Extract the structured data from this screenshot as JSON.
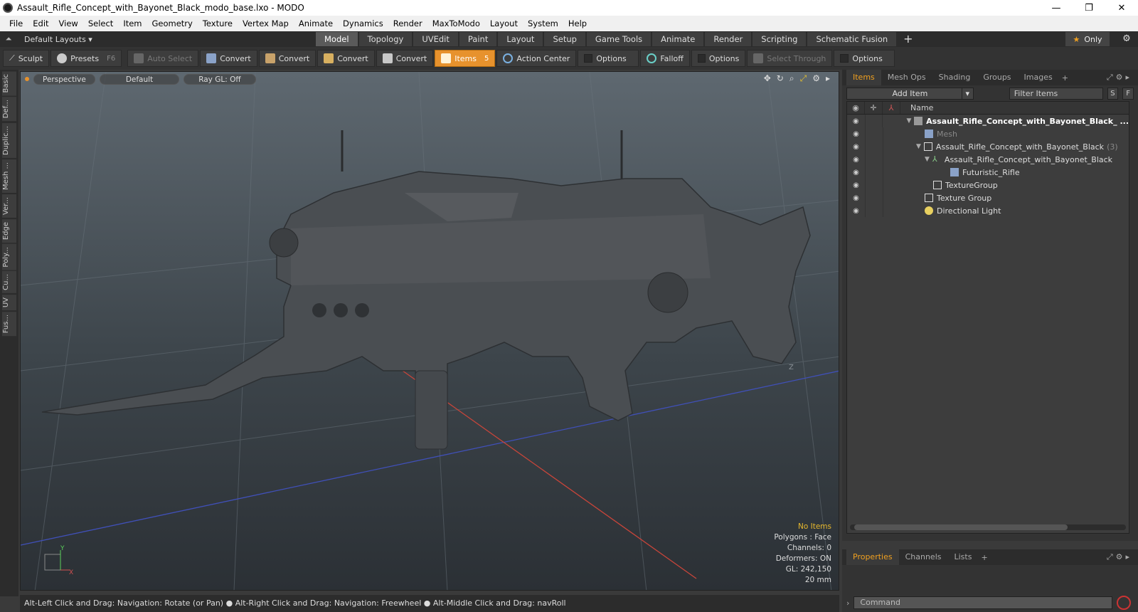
{
  "window": {
    "title": "Assault_Rifle_Concept_with_Bayonet_Black_modo_base.lxo - MODO",
    "minimize": "—",
    "maximize": "❐",
    "close": "✕"
  },
  "menu": [
    "File",
    "Edit",
    "View",
    "Select",
    "Item",
    "Geometry",
    "Texture",
    "Vertex Map",
    "Animate",
    "Dynamics",
    "Render",
    "MaxToModo",
    "Layout",
    "System",
    "Help"
  ],
  "layoutbar": {
    "layout_select": "Default Layouts ▾",
    "tabs": [
      "Model",
      "Topology",
      "UVEdit",
      "Paint",
      "Layout",
      "Setup",
      "Game Tools",
      "Animate",
      "Render",
      "Scripting",
      "Schematic Fusion"
    ],
    "active_tab": "Model",
    "add": "+",
    "only_label": "Only",
    "star": "★"
  },
  "toolbar": {
    "sculpt": "Sculpt",
    "presets": "Presets",
    "presets_key": "F6",
    "auto_select": "Auto Select",
    "convert1": "Convert",
    "convert2": "Convert",
    "convert3": "Convert",
    "convert4": "Convert",
    "items": "Items",
    "items_badge": "5",
    "action_center": "Action Center",
    "options1": "Options",
    "falloff": "Falloff",
    "options2": "Options",
    "select_through": "Select Through",
    "options3": "Options"
  },
  "leftstrip": [
    "Basic",
    "Def...",
    "Duplic...",
    "Mesh ...",
    "Ver...",
    "Edge",
    "Poly...",
    "Cu...",
    "UV",
    "Fus..."
  ],
  "viewport": {
    "view": "Perspective",
    "shading": "Default",
    "raygl": "Ray GL: Off",
    "info": {
      "no_items": "No Items",
      "polygons": "Polygons : Face",
      "channels": "Channels: 0",
      "deformers": "Deformers: ON",
      "gl": "GL: 242,150",
      "scale": "20 mm"
    },
    "axis_y": "Y",
    "axis_x": "X",
    "axis_z": "Z"
  },
  "items_panel": {
    "tabs": [
      "Items",
      "Mesh Ops",
      "Shading",
      "Groups",
      "Images"
    ],
    "active_tab": "Items",
    "add_tab": "+",
    "add_item": "Add Item",
    "filter_placeholder": "Filter Items",
    "s_btn": "S",
    "f_btn": "F",
    "name_header": "Name",
    "tree": [
      {
        "label": "Assault_Rifle_Concept_with_Bayonet_Black_ ...",
        "indent": 0,
        "style": "bold",
        "icon": "scene-icon",
        "tri": "▼"
      },
      {
        "label": "Mesh",
        "indent": 1,
        "style": "dim",
        "icon": "mesh-icon",
        "tri": ""
      },
      {
        "label": "Assault_Rifle_Concept_with_Bayonet_Black",
        "count": "(3)",
        "indent": 1,
        "style": "",
        "icon": "group-icon",
        "tri": "▼"
      },
      {
        "label": "Assault_Rifle_Concept_with_Bayonet_Black",
        "indent": 2,
        "style": "",
        "icon": "locator-icon",
        "tri": "▼"
      },
      {
        "label": "Futuristic_Rifle",
        "indent": 3,
        "style": "",
        "icon": "mesh-icon",
        "tri": ""
      },
      {
        "label": "TextureGroup",
        "indent": 2,
        "style": "",
        "icon": "group-icon",
        "tri": ""
      },
      {
        "label": "Texture Group",
        "indent": 1,
        "style": "",
        "icon": "group-icon",
        "tri": ""
      },
      {
        "label": "Directional Light",
        "indent": 1,
        "style": "",
        "icon": "light-icon",
        "tri": ""
      }
    ]
  },
  "properties_panel": {
    "tabs": [
      "Properties",
      "Channels",
      "Lists"
    ],
    "active_tab": "Properties",
    "add_tab": "+"
  },
  "command": {
    "placeholder": "Command"
  },
  "statusbar": {
    "text": "Alt-Left Click and Drag: Navigation: Rotate (or Pan) ● Alt-Right Click and Drag: Navigation: Freewheel ● Alt-Middle Click and Drag: navRoll"
  },
  "colors": {
    "accent": "#e7922d",
    "grid_x": "#c8453a",
    "grid_z": "#4050b8"
  }
}
